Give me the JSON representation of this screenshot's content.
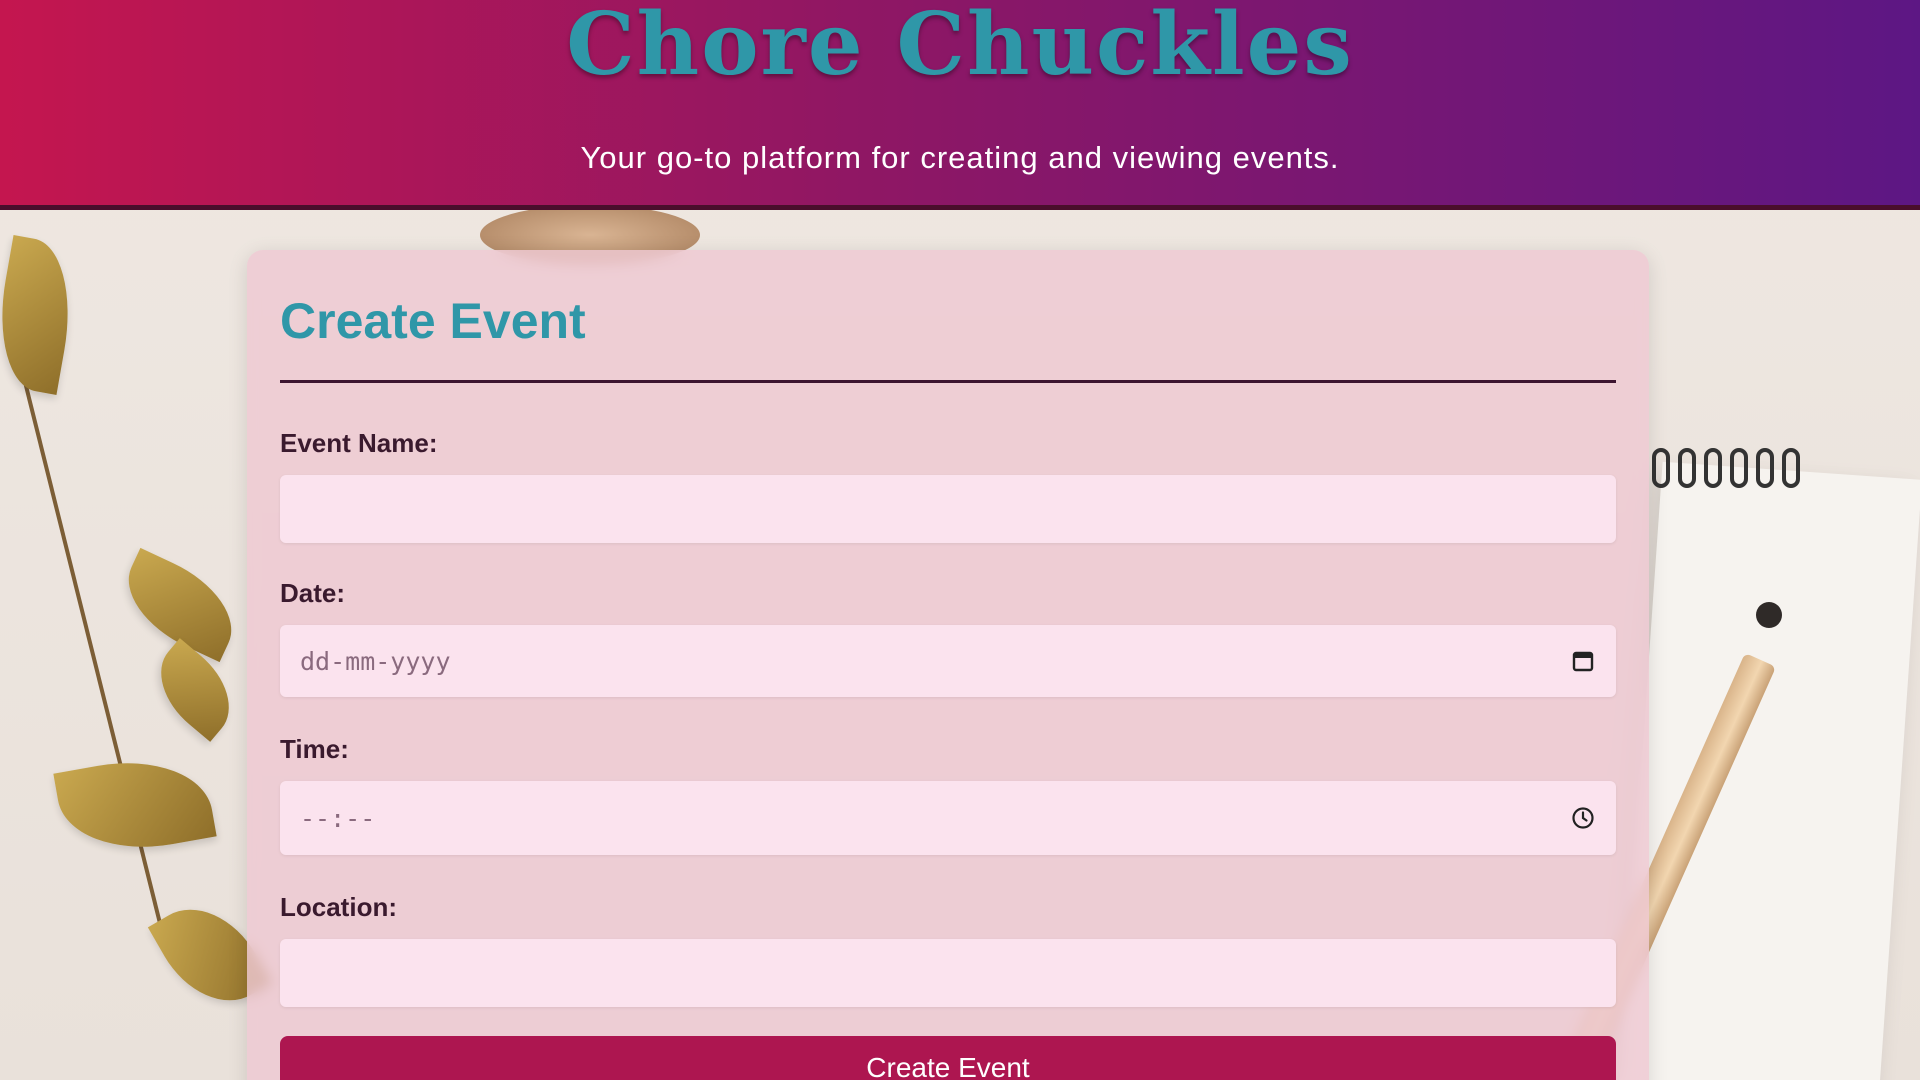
{
  "header": {
    "title": "Chore Chuckles",
    "tagline": "Your go-to platform for creating and viewing events."
  },
  "form": {
    "title": "Create Event",
    "fields": {
      "event_name": {
        "label": "Event Name:",
        "value": "",
        "placeholder": ""
      },
      "date": {
        "label": "Date:",
        "placeholder": "dd-mm-yyyy",
        "icon": "calendar-icon"
      },
      "time": {
        "label": "Time:",
        "placeholder": "--:--",
        "icon": "clock-icon"
      },
      "location": {
        "label": "Location:",
        "value": "",
        "placeholder": ""
      }
    },
    "submit_label": "Create Event"
  },
  "colors": {
    "header_start": "#c4164f",
    "header_end": "#5d1784",
    "accent_teal": "#2f97a8",
    "button": "#ad1650",
    "input_bg": "#fbe3ee"
  }
}
